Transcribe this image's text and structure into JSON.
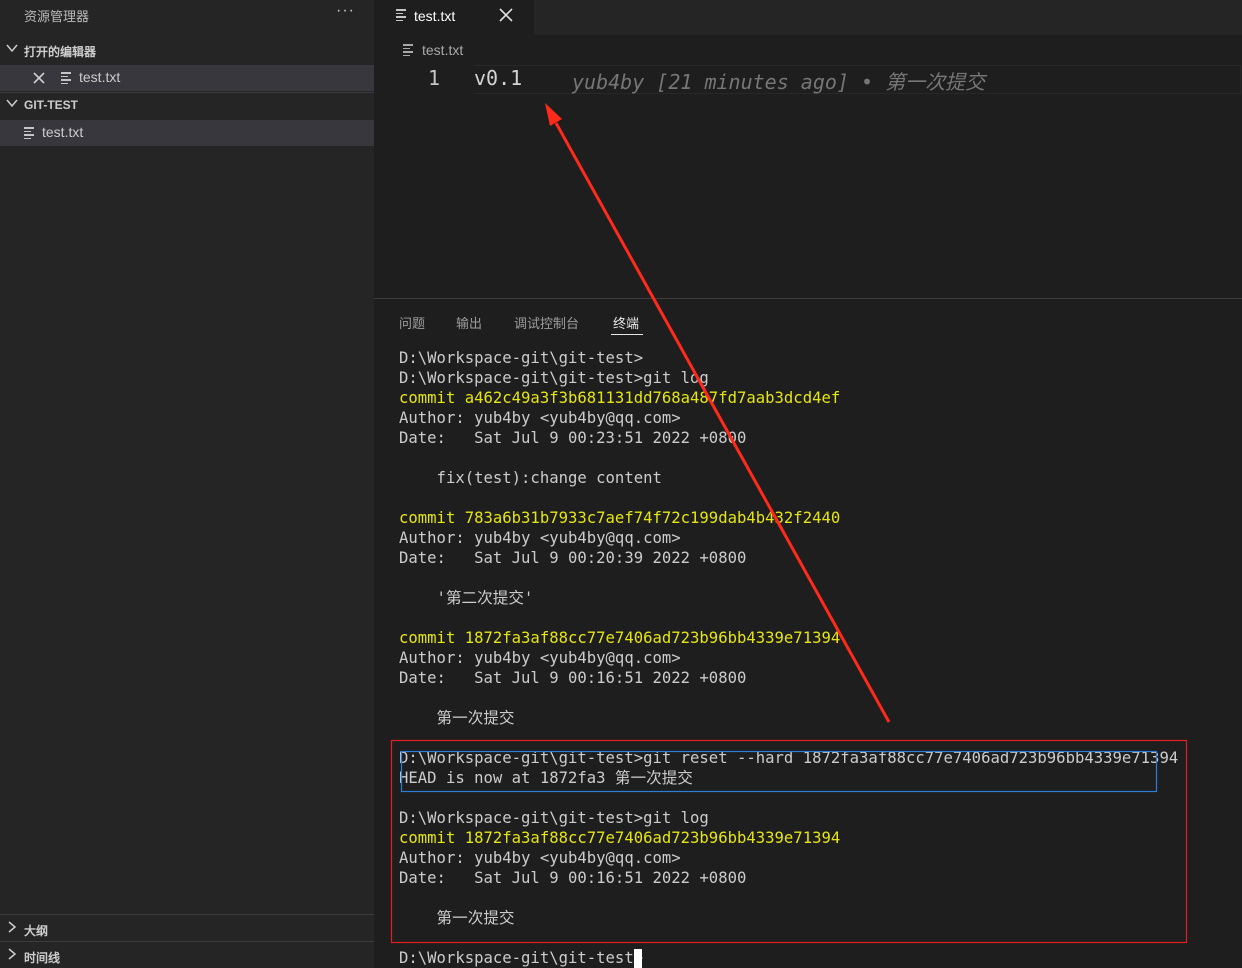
{
  "sidebar": {
    "title": "资源管理器",
    "more": "···",
    "open_editors": {
      "label": "打开的编辑器",
      "items": [
        {
          "label": "test.txt"
        }
      ]
    },
    "folder": {
      "label": "GIT-TEST",
      "items": [
        {
          "label": "test.txt"
        }
      ]
    },
    "outline_label": "大纲",
    "timeline_label": "时间线"
  },
  "editor": {
    "tab": {
      "label": "test.txt",
      "close": "✕"
    },
    "breadcrumb": "test.txt",
    "line_number": "1",
    "code": "v0.1",
    "blame": "yub4by [21 minutes ago] • 第一次提交"
  },
  "panel": {
    "tabs": [
      {
        "label": "问题",
        "active": false
      },
      {
        "label": "输出",
        "active": false
      },
      {
        "label": "调试控制台",
        "active": false
      },
      {
        "label": "终端",
        "active": true
      }
    ]
  },
  "terminal": {
    "lines": [
      {
        "text": "D:\\Workspace-git\\git-test>",
        "color": "default"
      },
      {
        "text": "D:\\Workspace-git\\git-test>git log",
        "color": "default"
      },
      {
        "text": "commit a462c49a3f3b681131dd768a487fd7aab3dcd4ef",
        "color": "yellow"
      },
      {
        "text": "Author: yub4by <yub4by@qq.com>",
        "color": "default"
      },
      {
        "text": "Date:   Sat Jul 9 00:23:51 2022 +0800",
        "color": "default"
      },
      {
        "text": "",
        "color": "default"
      },
      {
        "text": "    fix(test):change content",
        "color": "default"
      },
      {
        "text": "",
        "color": "default"
      },
      {
        "text": "commit 783a6b31b7933c7aef74f72c199dab4b432f2440",
        "color": "yellow"
      },
      {
        "text": "Author: yub4by <yub4by@qq.com>",
        "color": "default"
      },
      {
        "text": "Date:   Sat Jul 9 00:20:39 2022 +0800",
        "color": "default"
      },
      {
        "text": "",
        "color": "default"
      },
      {
        "text": "    '第二次提交'",
        "color": "default"
      },
      {
        "text": "",
        "color": "default"
      },
      {
        "text": "commit 1872fa3af88cc77e7406ad723b96bb4339e71394",
        "color": "yellow"
      },
      {
        "text": "Author: yub4by <yub4by@qq.com>",
        "color": "default"
      },
      {
        "text": "Date:   Sat Jul 9 00:16:51 2022 +0800",
        "color": "default"
      },
      {
        "text": "",
        "color": "default"
      },
      {
        "text": "    第一次提交",
        "color": "default"
      },
      {
        "text": "",
        "color": "default"
      },
      {
        "text": "D:\\Workspace-git\\git-test>git reset --hard 1872fa3af88cc77e7406ad723b96bb4339e71394",
        "color": "default"
      },
      {
        "text": "HEAD is now at 1872fa3 第一次提交",
        "color": "default"
      },
      {
        "text": "",
        "color": "default"
      },
      {
        "text": "D:\\Workspace-git\\git-test>git log",
        "color": "default"
      },
      {
        "text": "commit 1872fa3af88cc77e7406ad723b96bb4339e71394",
        "color": "yellow"
      },
      {
        "text": "Author: yub4by <yub4by@qq.com>",
        "color": "default"
      },
      {
        "text": "Date:   Sat Jul 9 00:16:51 2022 +0800",
        "color": "default"
      },
      {
        "text": "",
        "color": "default"
      },
      {
        "text": "    第一次提交",
        "color": "default"
      },
      {
        "text": "",
        "color": "default"
      },
      {
        "text": "D:\\Workspace-git\\git-test>",
        "color": "default"
      }
    ]
  },
  "annotations": {
    "arrow_color": "#ff2a1a",
    "outer_box_color": "#e02020",
    "inner_box_color": "#2a7ed8"
  },
  "colors": {
    "sidebar_bg": "#252526",
    "editor_bg": "#1e1e1e",
    "terminal_yellow": "#e5e510",
    "selection_bg": "#37373d"
  }
}
